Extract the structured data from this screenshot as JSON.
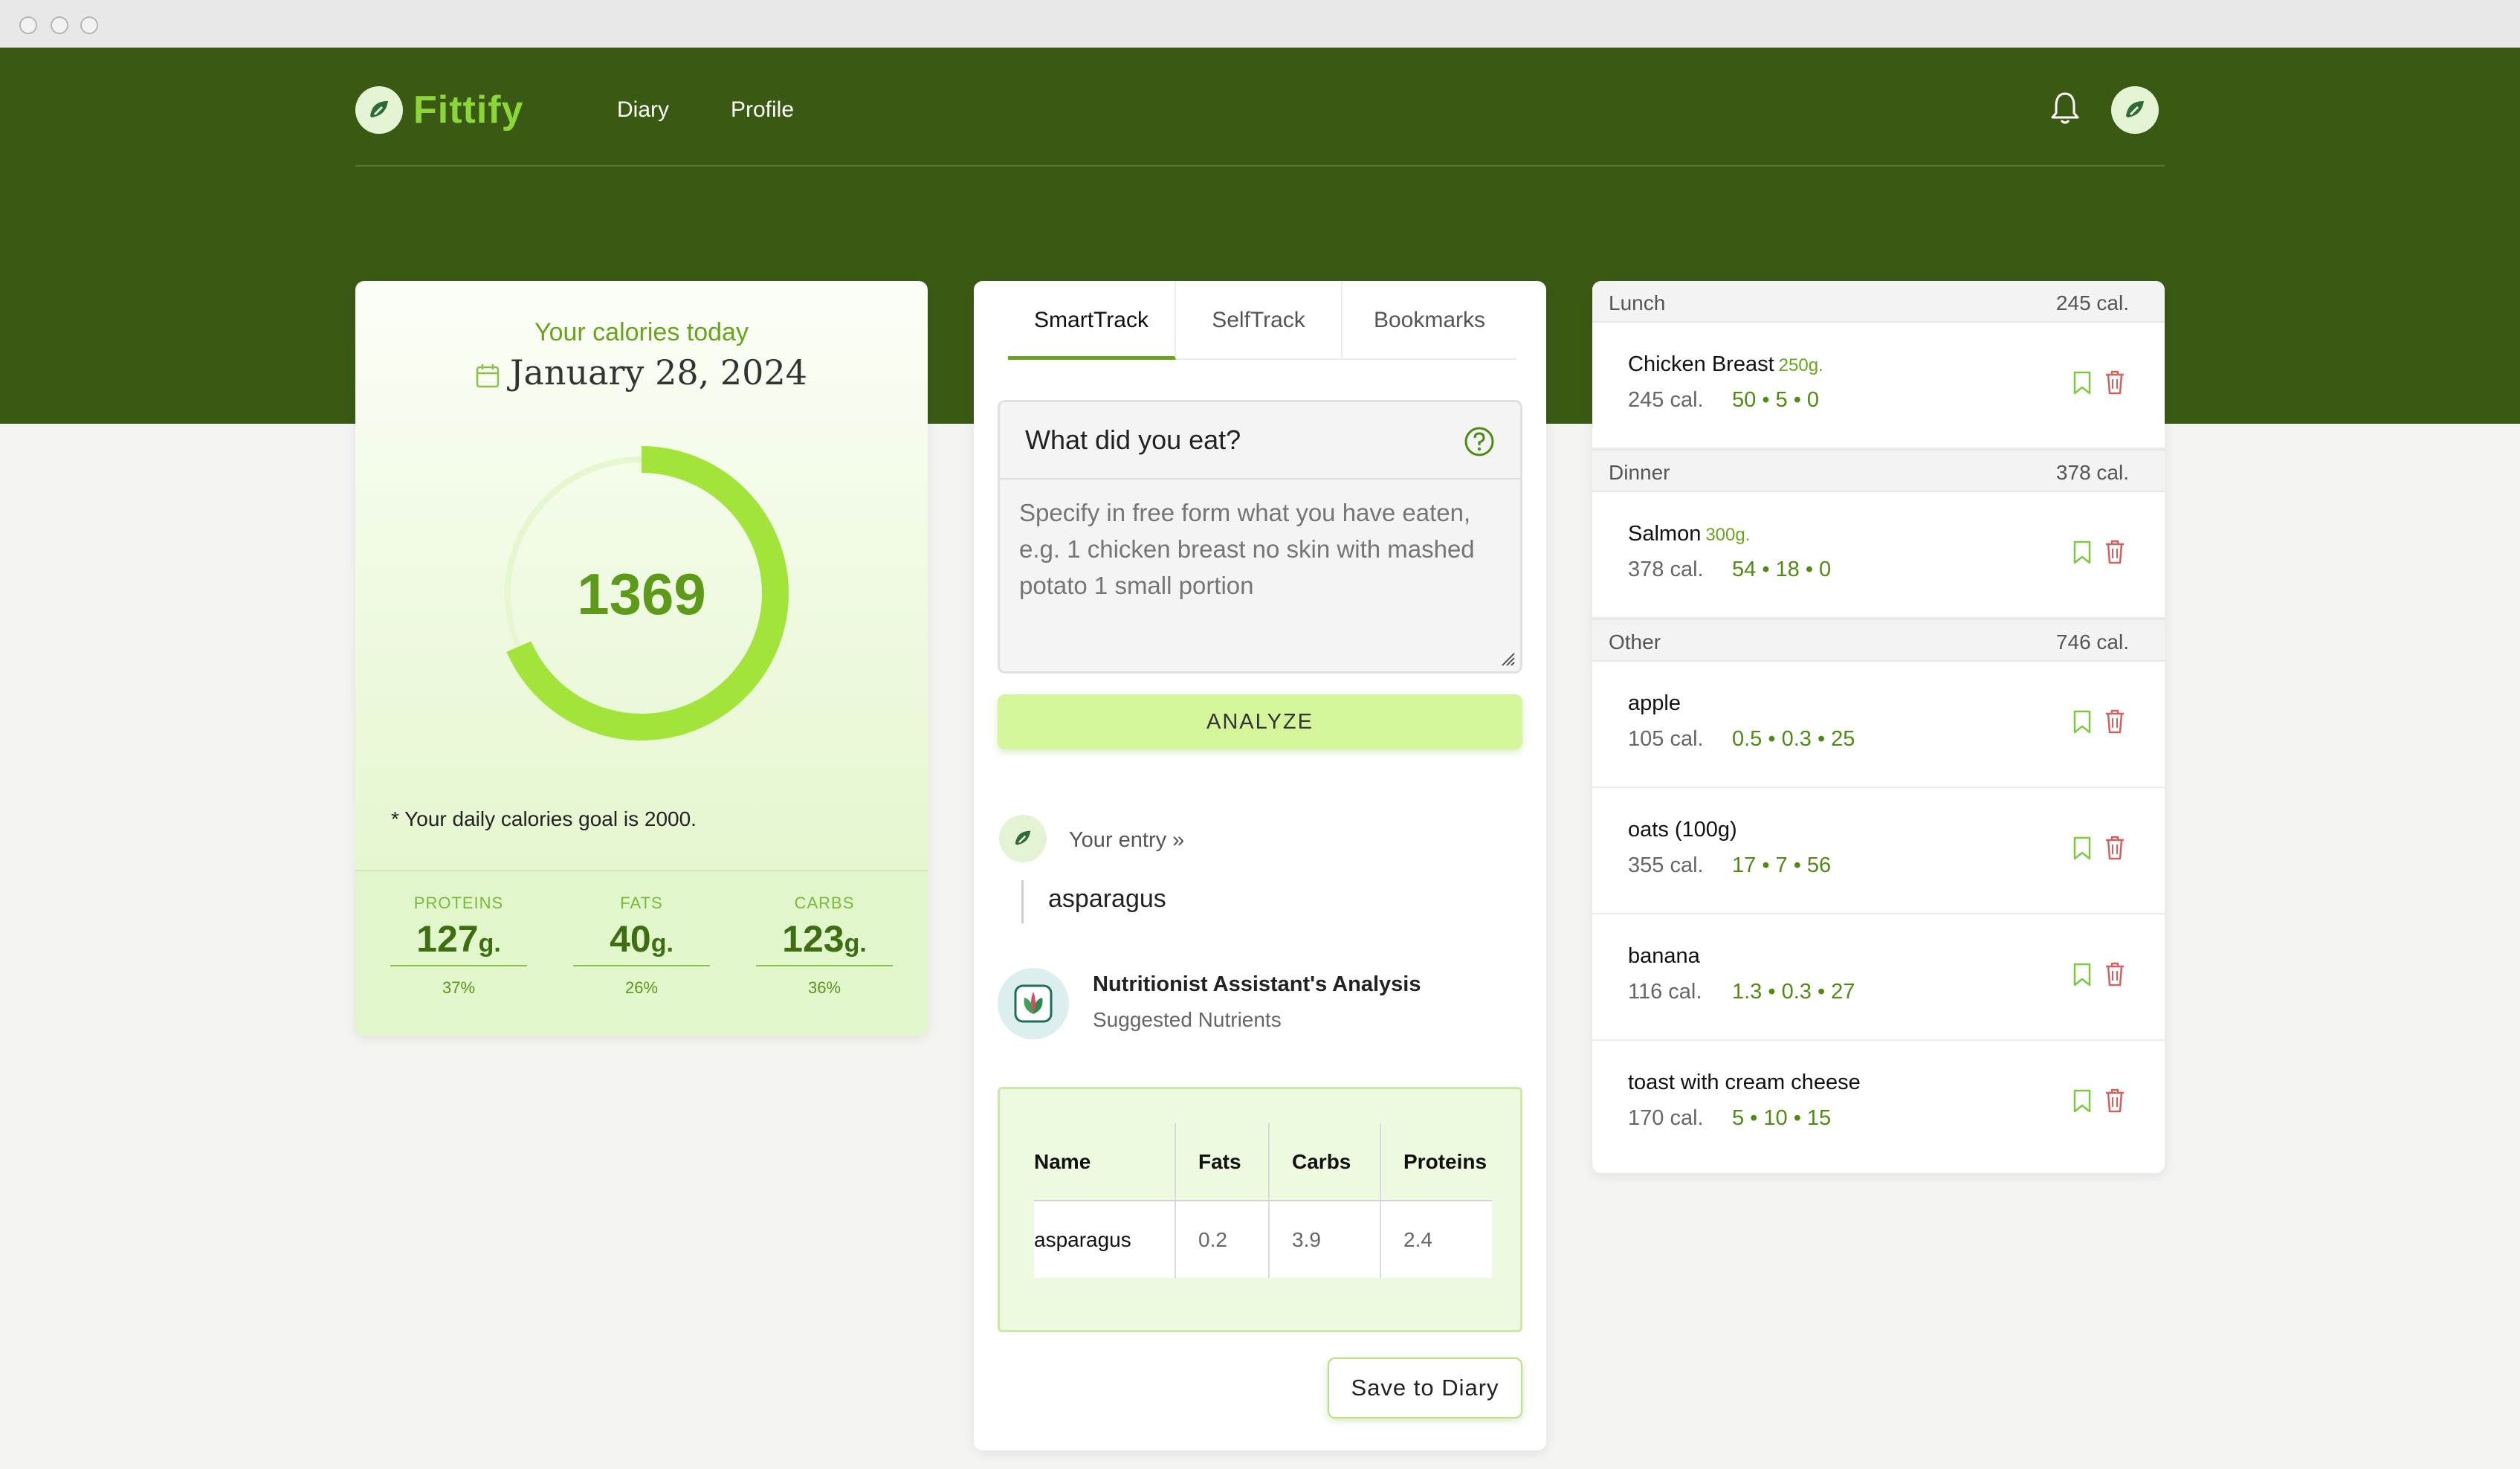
{
  "app": {
    "brand": "Fittify",
    "accent": "#8cd63a",
    "header_bg": "#3a5a14"
  },
  "nav": {
    "links": [
      "Diary",
      "Profile"
    ],
    "bell_icon": "bell-icon",
    "avatar_icon": "leaf-avatar-icon"
  },
  "calories": {
    "title": "Your calories today",
    "date": "January 28, 2024",
    "consumed": "1369",
    "consumed_value": 1369,
    "goal_value": 2000,
    "goal_text": "* Your daily calories goal is 2000.",
    "macros": [
      {
        "label": "PROTEINS",
        "value": "127",
        "unit": "g.",
        "pct": "37%"
      },
      {
        "label": "FATS",
        "value": "40",
        "unit": "g.",
        "pct": "26%"
      },
      {
        "label": "CARBS",
        "value": "123",
        "unit": "g.",
        "pct": "36%"
      }
    ]
  },
  "track": {
    "tabs": [
      "SmartTrack",
      "SelfTrack",
      "Bookmarks"
    ],
    "active_tab": "SmartTrack",
    "question": "What did you eat?",
    "placeholder": "Specify in free form what you have eaten, e.g. 1 chicken breast no skin with mashed potato 1 small portion",
    "analyze_label": "ANALYZE",
    "entry_label": "Your entry »",
    "entry_value": "asparagus",
    "assistant_title": "Nutritionist Assistant's Analysis",
    "assistant_sub": "Suggested Nutrients",
    "table": {
      "headers": [
        "Name",
        "Fats",
        "Carbs",
        "Proteins"
      ],
      "rows": [
        [
          "asparagus",
          "0.2",
          "3.9",
          "2.4"
        ]
      ]
    },
    "save_label": "Save to Diary"
  },
  "diary": {
    "sections": [
      {
        "name": "Lunch",
        "cal": "245 cal.",
        "items": [
          {
            "name": "Chicken Breast",
            "weight": "250g.",
            "cal": "245 cal.",
            "macros": "50 • 5 • 0"
          }
        ]
      },
      {
        "name": "Dinner",
        "cal": "378 cal.",
        "items": [
          {
            "name": "Salmon",
            "weight": "300g.",
            "cal": "378 cal.",
            "macros": "54 • 18 • 0"
          }
        ]
      },
      {
        "name": "Other",
        "cal": "746 cal.",
        "items": [
          {
            "name": "apple",
            "weight": "",
            "cal": "105 cal.",
            "macros": "0.5 • 0.3 • 25"
          },
          {
            "name": "oats (100g)",
            "weight": "",
            "cal": "355 cal.",
            "macros": "17 • 7 • 56"
          },
          {
            "name": "banana",
            "weight": "",
            "cal": "116 cal.",
            "macros": "1.3 • 0.3 • 27"
          },
          {
            "name": "toast with cream cheese",
            "weight": "",
            "cal": "170 cal.",
            "macros": "5 • 10 • 15"
          }
        ]
      }
    ]
  }
}
